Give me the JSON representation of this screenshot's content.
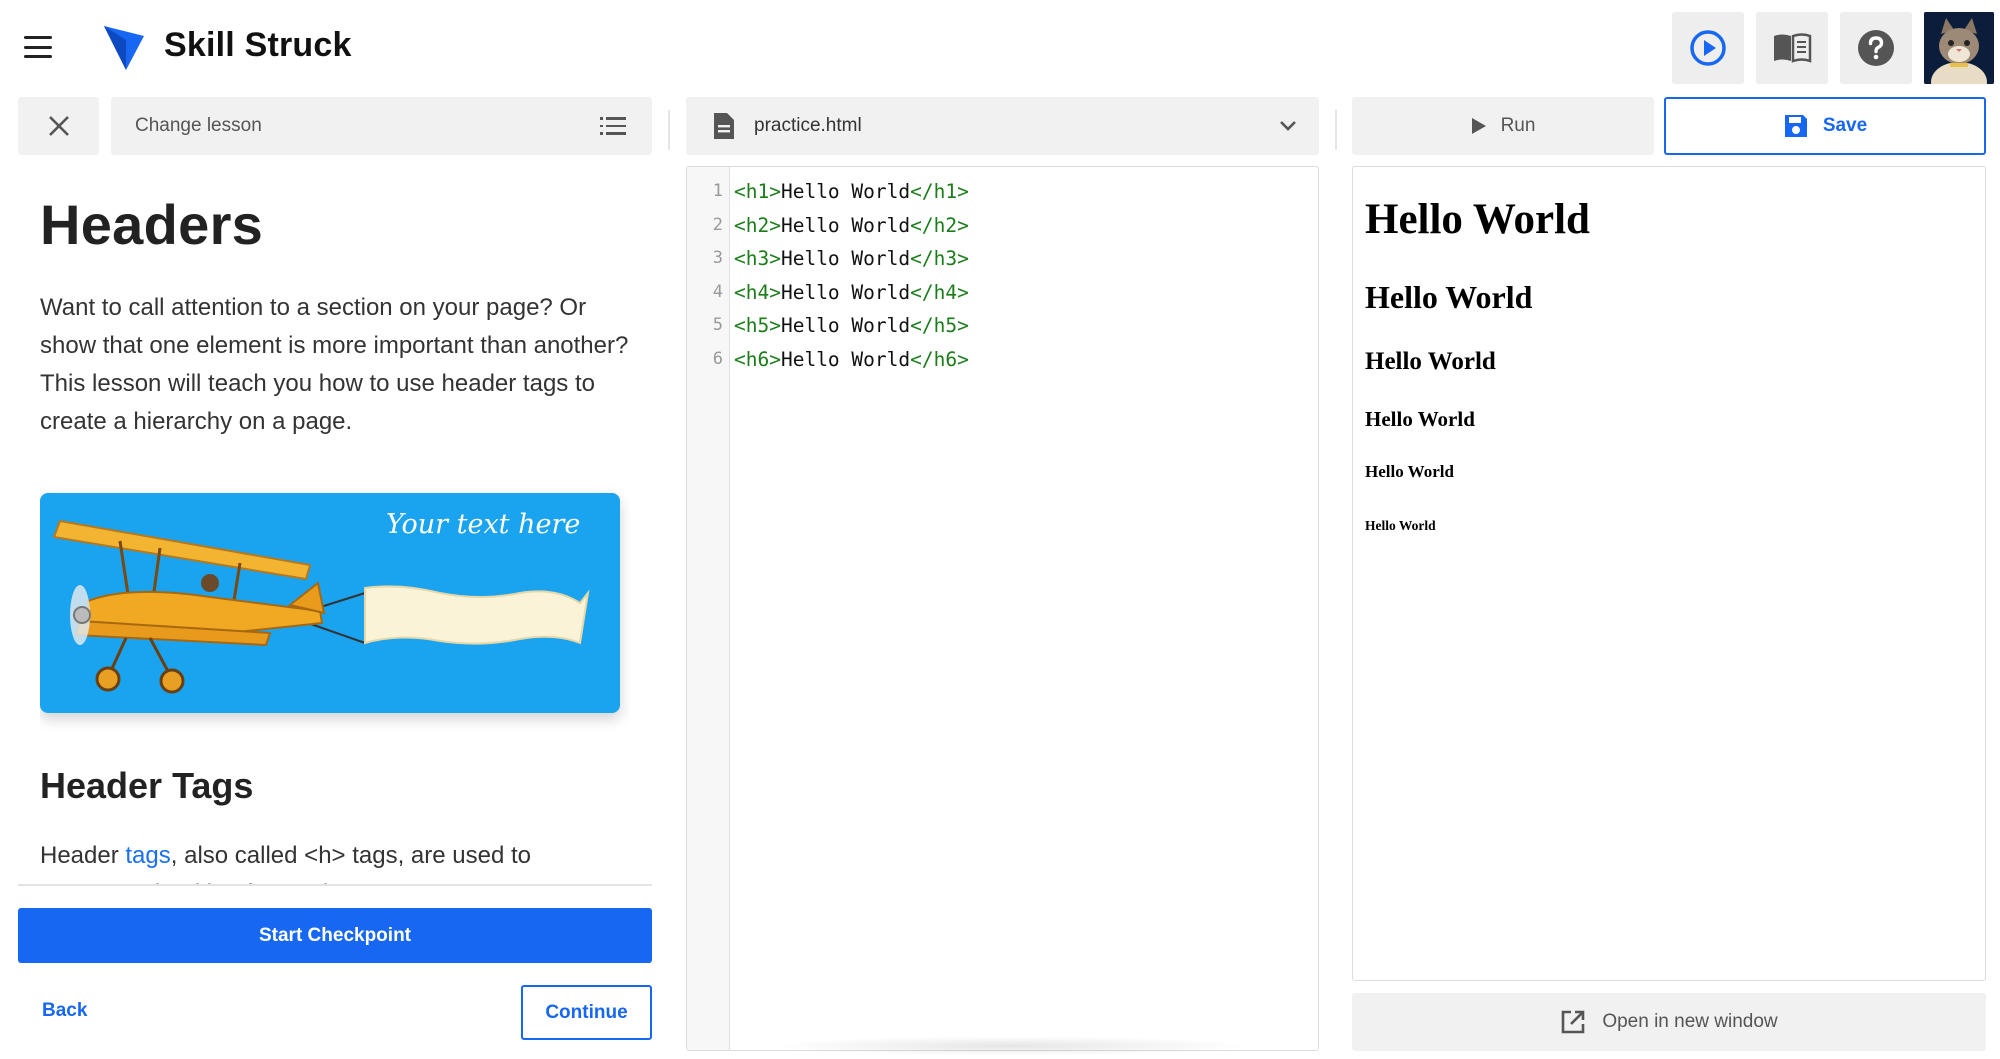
{
  "header": {
    "brand": "Skill Struck",
    "menu_icon": "hamburger-menu-icon",
    "logo_icon": "skill-struck-logo-icon",
    "buttons": [
      {
        "icon": "play-circle-icon"
      },
      {
        "icon": "open-book-icon"
      },
      {
        "icon": "help-circle-icon"
      }
    ],
    "avatar": "cat-avatar"
  },
  "lesson_panel": {
    "change_lesson_label": "Change lesson",
    "title": "Headers",
    "intro": "Want to call attention to a section on your page? Or show that one element is more important than another? This lesson will teach you how to use header tags to create a hierarchy on a page.",
    "banner_text": "Your text here",
    "section_title": "Header Tags",
    "body_before_link": "Header ",
    "body_link": "tags",
    "body_after_link": ", also called <h> tags, are used to represent the title of a section or page on a",
    "start_checkpoint_label": "Start Checkpoint",
    "back_label": "Back",
    "continue_label": "Continue"
  },
  "editor": {
    "file_name": "practice.html",
    "lines": [
      {
        "num": "1",
        "open": "<h1>",
        "text": "Hello World",
        "close": "</h1>"
      },
      {
        "num": "2",
        "open": "<h2>",
        "text": "Hello World",
        "close": "</h2>"
      },
      {
        "num": "3",
        "open": "<h3>",
        "text": "Hello World",
        "close": "</h3>"
      },
      {
        "num": "4",
        "open": "<h4>",
        "text": "Hello World",
        "close": "</h4>"
      },
      {
        "num": "5",
        "open": "<h5>",
        "text": "Hello World",
        "close": "</h5>"
      },
      {
        "num": "6",
        "open": "<h6>",
        "text": "Hello World",
        "close": "</h6>"
      }
    ]
  },
  "preview": {
    "run_label": "Run",
    "save_label": "Save",
    "headings": [
      "Hello World",
      "Hello World",
      "Hello World",
      "Hello World",
      "Hello World",
      "Hello World"
    ],
    "open_new_window_label": "Open in new window"
  },
  "colors": {
    "accent": "#1767f2",
    "banner": "#1aa3ee",
    "code_tag": "#1a7d1a",
    "button_bg": "#f1f1f1"
  }
}
